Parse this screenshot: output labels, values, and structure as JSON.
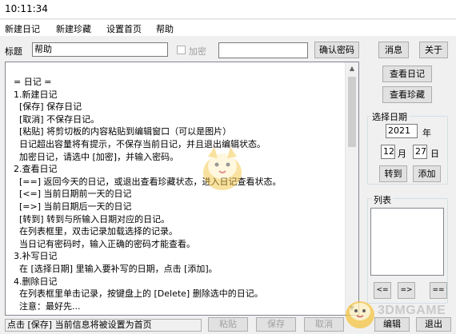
{
  "window": {
    "title": "10:11:34"
  },
  "menu": [
    "新建日记",
    "新建珍藏",
    "设置首页",
    "帮助"
  ],
  "toolbar": {
    "title_label": "标题",
    "title_value": "帮助",
    "encrypt_label": "加密",
    "password_value": "",
    "confirm_password": "确认密码",
    "message": "消息",
    "about": "关于"
  },
  "side": {
    "view_diary": "查看日记",
    "view_collection": "查看珍藏",
    "select_date": "选择日期",
    "year_value": "2021",
    "year_unit": "年",
    "month_value": "12",
    "month_unit": "月",
    "day_value": "27",
    "day_unit": "日",
    "goto": "转到",
    "add": "添加",
    "list_label": "列表",
    "nav_prev": "<=",
    "nav_next": "=>",
    "nav_eq": "=="
  },
  "content_lines": [
    "= 日记 =",
    "1.新建日记",
    "  [保存] 保存日记",
    "  [取消] 不保存日记。",
    "  [粘贴] 将剪切板的内容粘贴到编辑窗口（可以是图片）",
    "  日记超出容量将有提示，不保存当前日记，并且退出编辑状态。",
    "  加密日记，请选中 [加密]，并输入密码。",
    "2.查看日记",
    "  [==] 返回今天的日记，或退出查看珍藏状态，进入日记查看状态。",
    "  [<=] 当前日期前一天的日记",
    "  [=>] 当前日期后一天的日记",
    "  [转到] 转到与所输入日期对应的日记。",
    "  在列表框里，双击记录加载选择的记录。",
    "  当日记有密码时，输入正确的密码才能查看。",
    "3.补写日记",
    "  在 [选择日期] 里输入要补写的日期，点击 [添加]。",
    "4.删除日记",
    "  在列表框里单击记录，按键盘上的 [Delete] 删除选中的日记。",
    "  注意：最好先..."
  ],
  "bottom": {
    "status": "点击 [保存] 当前信息将被设置为首页",
    "paste": "粘贴",
    "save": "保存",
    "cancel": "取消",
    "edit": "编辑",
    "exit": "退出"
  },
  "watermark": "3DMGAME"
}
